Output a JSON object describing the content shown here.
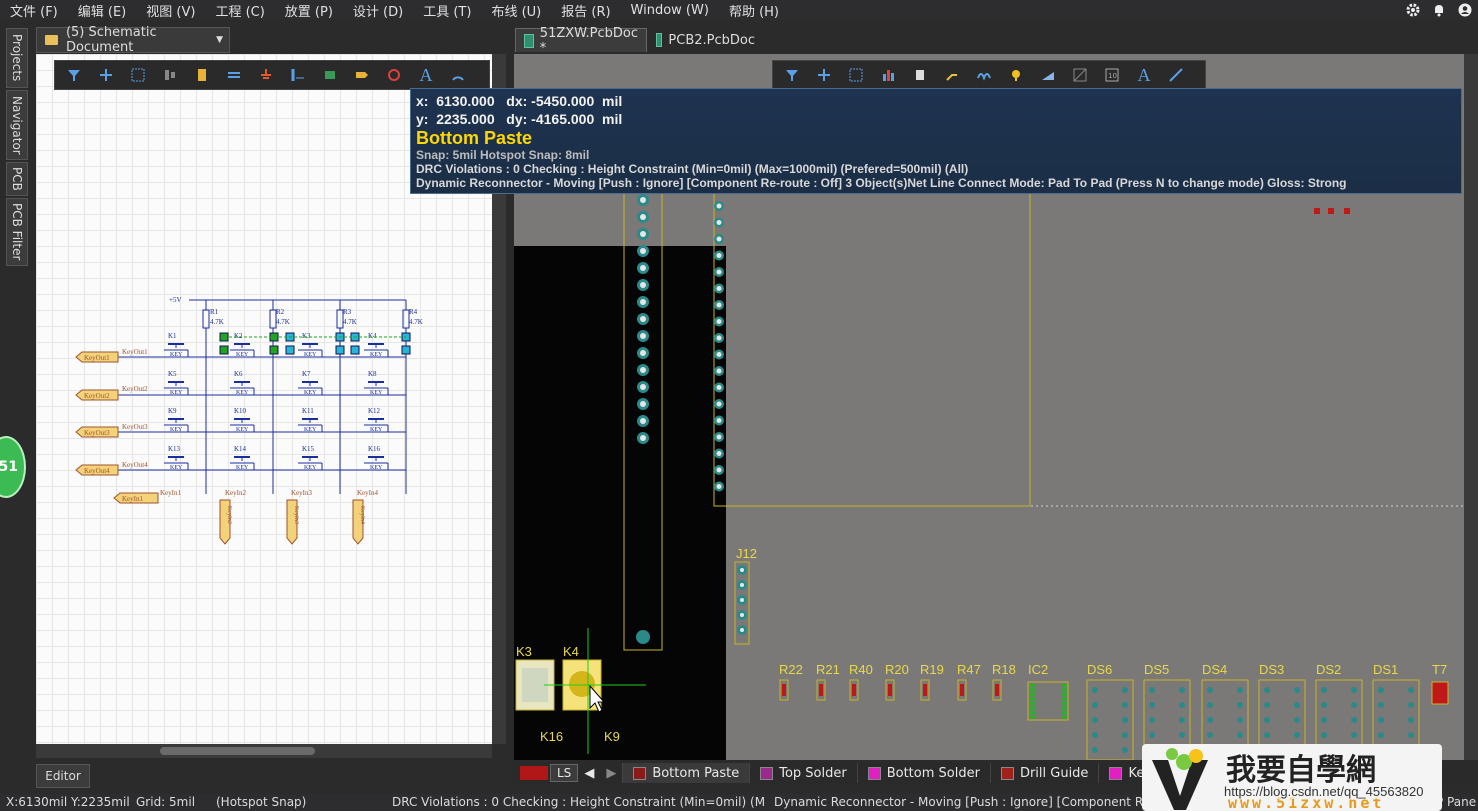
{
  "menu": [
    "文件 (F)",
    "编辑 (E)",
    "视图 (V)",
    "工程 (C)",
    "放置 (P)",
    "设计 (D)",
    "工具 (T)",
    "布线 (U)",
    "报告 (R)",
    "Window (W)",
    "帮助 (H)"
  ],
  "side_tabs": [
    "Projects",
    "Navigator",
    "PCB",
    "PCB Filter"
  ],
  "schematic": {
    "tab_label": "(5) Schematic Document",
    "editor_tab": "Editor",
    "power_label": "+5V",
    "resistors": [
      {
        "ref": "R1",
        "value": "4.7K"
      },
      {
        "ref": "R2",
        "value": "4.7K"
      },
      {
        "ref": "R3",
        "value": "4.7K"
      },
      {
        "ref": "R4",
        "value": "4.7K"
      }
    ],
    "keys": [
      "K1",
      "K2",
      "K3",
      "K4",
      "K5",
      "K6",
      "K7",
      "K8",
      "K9",
      "K10",
      "K11",
      "K12",
      "K13",
      "K14",
      "K15",
      "K16"
    ],
    "key_value": "KEY",
    "out_ports": [
      "KeyOut1",
      "KeyOut2",
      "KeyOut3",
      "KeyOut4"
    ],
    "in_port": "KeyIn1",
    "in_nets": [
      "KeyIn1",
      "KeyIn2",
      "KeyIn3",
      "KeyIn4"
    ],
    "in_ports_vertical": [
      "KeyIn2",
      "KeyIn3",
      "KeyIn4"
    ]
  },
  "badge": "51",
  "pcb": {
    "tabs": [
      {
        "label": "51ZXW.PcbDoc *",
        "active": true
      },
      {
        "label": "PCB2.PcbDoc",
        "active": false
      }
    ],
    "hud": {
      "coord_line1": "x:  6130.000   dx: -5450.000  mil",
      "coord_line2": "y:  2235.000   dy: -4165.000  mil",
      "layer": "Bottom Paste",
      "snap": "Snap: 5mil Hotspot Snap: 8mil",
      "drc": "DRC Violations : 0 Checking : Height Constraint (Min=0mil) (Max=1000mil) (Prefered=500mil) (All)",
      "dynamic": "Dynamic Reconnector - Moving [Push : Ignore] [Component Re-route : Off] 3 Object(s)Net Line Connect Mode: Pad To Pad (Press N to change mode) Gloss: Strong"
    },
    "designators": [
      "J12",
      "K3",
      "K4",
      "K16",
      "K9",
      "R22",
      "R21",
      "R40",
      "R20",
      "R19",
      "R47",
      "R18",
      "IC2",
      "DS6",
      "DS5",
      "DS4",
      "DS3",
      "DS2",
      "DS1",
      "T7"
    ]
  },
  "layers": {
    "ls_label": "LS",
    "items": [
      {
        "label": "Bottom Paste",
        "color": "#8b1a1a",
        "active": true
      },
      {
        "label": "Top Solder",
        "color": "#9c2a8c",
        "active": false
      },
      {
        "label": "Bottom Solder",
        "color": "#e020c0",
        "active": false
      },
      {
        "label": "Drill Guide",
        "color": "#a0201a",
        "active": false
      },
      {
        "label": "Keep-Out",
        "color": "#e020c0",
        "active": false
      }
    ]
  },
  "status": {
    "coords": "X:6130mil Y:2235mil",
    "grid": "Grid: 5mil",
    "hotspot": "(Hotspot Snap)",
    "drc": "DRC Violations : 0 Checking : Height Constraint (Min=0mil) (M",
    "dynamic": "Dynamic Reconnector - Moving [Push : Ignore] [Component R",
    "panels": "P Pane"
  },
  "watermark": {
    "brand": "我要自學網",
    "site": "www.51zxw.net",
    "url": "https://blog.csdn.net/qq_45563820"
  }
}
